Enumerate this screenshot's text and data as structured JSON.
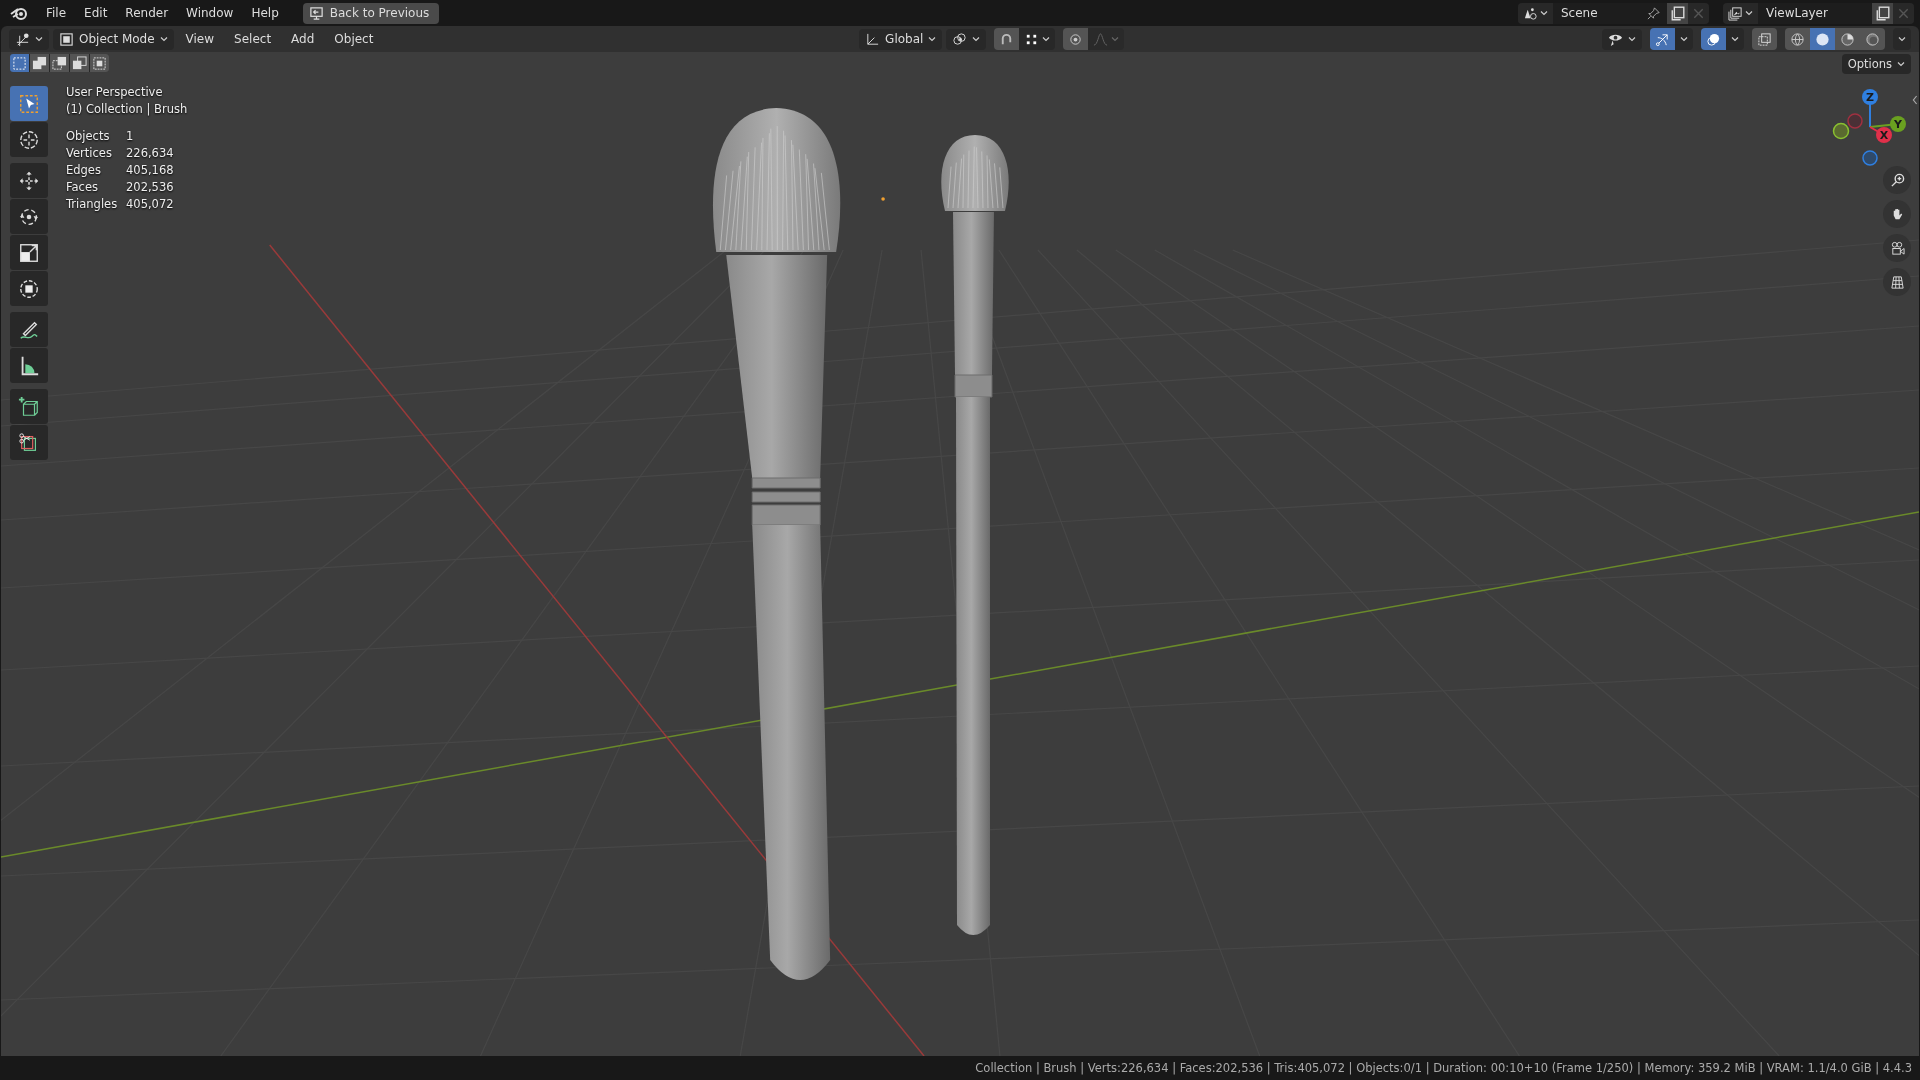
{
  "menu": [
    "File",
    "Edit",
    "Render",
    "Window",
    "Help"
  ],
  "back_button": "Back to Previous",
  "scene": "Scene",
  "view_layer": "ViewLayer",
  "header": {
    "mode": "Object Mode",
    "menus": [
      "View",
      "Select",
      "Add",
      "Object"
    ],
    "orientation": "Global",
    "snap_on": false,
    "proportional_on": false
  },
  "display": {
    "gizmos_on": true,
    "overlays_on": true,
    "xray_on": false,
    "shading": [
      {
        "kind": "wireframe",
        "selected": false
      },
      {
        "kind": "solid",
        "selected": true
      },
      {
        "kind": "material",
        "selected": false
      },
      {
        "kind": "rendered",
        "selected": false
      }
    ]
  },
  "select_modes": [
    {
      "kind": "new",
      "selected": true
    },
    {
      "kind": "extend",
      "selected": false
    },
    {
      "kind": "subtract",
      "selected": false
    },
    {
      "kind": "invert",
      "selected": false
    },
    {
      "kind": "intersect",
      "selected": false
    }
  ],
  "options_label": "Options",
  "tools": [
    {
      "kind": "select",
      "selected": true
    },
    {
      "kind": "cursor",
      "selected": false
    },
    {
      "kind": "move",
      "selected": false
    },
    {
      "kind": "rotate",
      "selected": false
    },
    {
      "kind": "scale",
      "selected": false
    },
    {
      "kind": "transform",
      "selected": false
    },
    {
      "kind": "annotate",
      "selected": false
    },
    {
      "kind": "measure",
      "selected": false
    },
    {
      "kind": "add-cube",
      "selected": false
    },
    {
      "kind": "cut",
      "selected": false
    }
  ],
  "viewport": {
    "title": "User Perspective",
    "subtitle": "(1) Collection | Brush",
    "stats": [
      {
        "label": "Objects",
        "value": "1"
      },
      {
        "label": "Vertices",
        "value": "226,634"
      },
      {
        "label": "Edges",
        "value": "405,168"
      },
      {
        "label": "Faces",
        "value": "202,536"
      },
      {
        "label": "Triangles",
        "value": "405,072"
      }
    ]
  },
  "axes": {
    "z": "Z",
    "y": "Y",
    "x": "X"
  },
  "status_bar": "Collection | Brush | Verts:226,634 | Faces:202,536 | Tris:405,072 | Objects:0/1 | Duration: 00:10+10 (Frame 1/250) | Memory: 359.2 MiB | VRAM: 1.1/4.0 GiB | 4.4.3"
}
